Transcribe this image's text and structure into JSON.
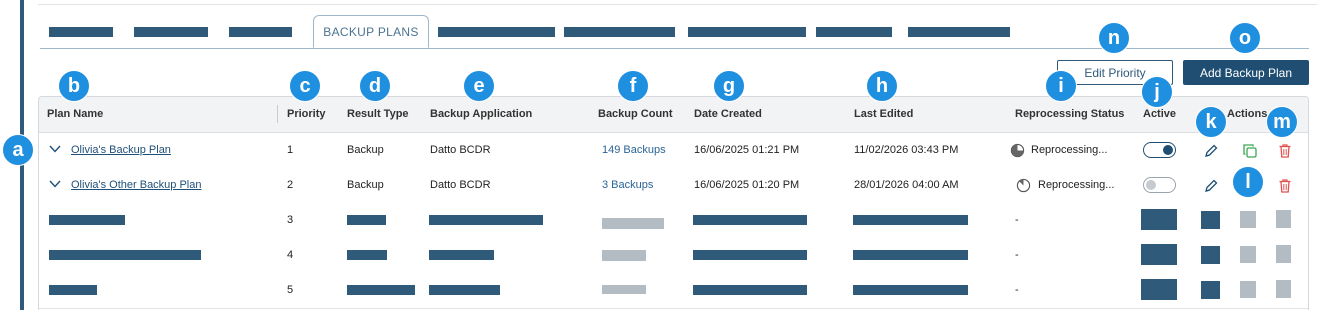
{
  "tabs": {
    "active_label": "BACKUP PLANS"
  },
  "buttons": {
    "edit_priority": "Edit Priority",
    "add_backup_plan": "Add Backup Plan"
  },
  "table": {
    "headers": {
      "plan_name": "Plan Name",
      "priority": "Priority",
      "result_type": "Result Type",
      "backup_application": "Backup Application",
      "backup_count": "Backup Count",
      "date_created": "Date Created",
      "last_edited": "Last Edited",
      "reprocessing_status": "Reprocessing Status",
      "active": "Active",
      "actions": "Actions"
    },
    "rows": [
      {
        "plan_name": "Olivia's Backup Plan",
        "priority": "1",
        "result_type": "Backup",
        "backup_application": "Datto BCDR",
        "backup_count": "149 Backups",
        "date_created": "16/06/2025 01:21 PM",
        "last_edited": "11/02/2026 03:43 PM",
        "reprocessing_status": "Reprocessing...",
        "active": true
      },
      {
        "plan_name": "Olivia's Other Backup Plan",
        "priority": "2",
        "result_type": "Backup",
        "backup_application": "Datto BCDR",
        "backup_count": "3 Backups",
        "date_created": "16/06/2025 01:20 PM",
        "last_edited": "28/01/2026 04:00 AM",
        "reprocessing_status": "Reprocessing...",
        "active": false
      },
      {
        "priority": "3",
        "reprocessing_status": "-"
      },
      {
        "priority": "4",
        "reprocessing_status": "-"
      },
      {
        "priority": "5",
        "reprocessing_status": "-"
      }
    ]
  },
  "callouts": [
    "a",
    "b",
    "c",
    "d",
    "e",
    "f",
    "g",
    "h",
    "i",
    "j",
    "k",
    "l",
    "m",
    "n",
    "o"
  ],
  "colors": {
    "brand": "#1f4e72",
    "callout": "#1f8fe0",
    "delete": "#e0524f",
    "copy": "#3aa655",
    "placeholder": "#2f5a7a"
  }
}
